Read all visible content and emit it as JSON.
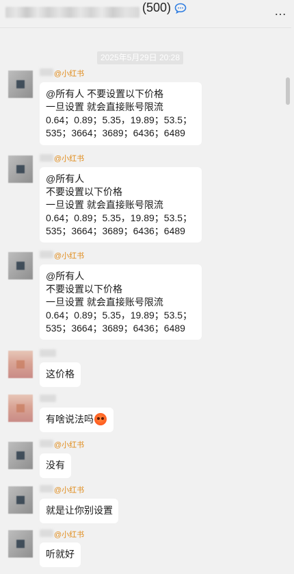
{
  "header": {
    "title_count": "(500)",
    "chat_icon": "chat-bubble-icon",
    "more_label": "…"
  },
  "time_badge": "2025年5月29日 20:28",
  "messages": [
    {
      "tag": "@小红书",
      "text": "@所有人 不要设置以下价格\n一旦设置 就会直接账号限流\n0.64；0.89；5.35，19.89；53.5；\n535；3664；3689；6436；6489"
    },
    {
      "tag": "@小红书",
      "text": "@所有人\n不要设置以下价格\n一旦设置 就会直接账号限流\n0.64；0.89；5.35，19.89；53.5；\n535；3664；3689；6436；6489"
    },
    {
      "tag": "@小红书",
      "text": "@所有人\n不要设置以下价格\n一旦设置 就会直接账号限流\n0.64；0.89；5.35，19.89；53.5；\n535；3664；3689；6436；6489"
    },
    {
      "tag": "",
      "text": "这价格"
    },
    {
      "tag": "",
      "text": "有啥说法吗",
      "emoji": "angry-face-icon"
    },
    {
      "tag": "@小红书",
      "text": "没有"
    },
    {
      "tag": "@小红书",
      "text": "就是让你别设置"
    },
    {
      "tag": "@小红书",
      "text": "听就好"
    }
  ]
}
